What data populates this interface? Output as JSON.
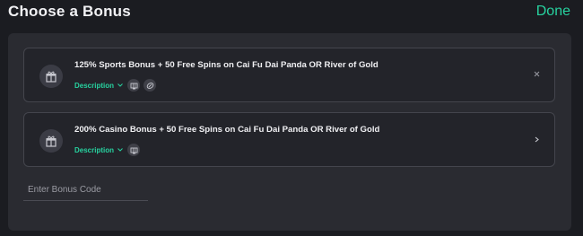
{
  "header": {
    "title": "Choose a Bonus",
    "done_label": "Done"
  },
  "bonuses": [
    {
      "title": "125% Sports Bonus + 50 Free Spins on Cai Fu Dai Panda OR River of Gold",
      "description_label": "Description",
      "icons": [
        "gift-icon",
        "slot-machine-icon",
        "sports-ball-icon"
      ],
      "action_icon": "close-icon"
    },
    {
      "title": "200% Casino Bonus + 50 Free Spins on Cai Fu Dai Panda OR River of Gold",
      "description_label": "Description",
      "icons": [
        "gift-icon",
        "slot-machine-icon"
      ],
      "action_icon": "chevron-right-icon"
    }
  ],
  "bonus_code": {
    "placeholder": "Enter Bonus Code",
    "value": ""
  },
  "colors": {
    "accent": "#27d3a0",
    "background": "#1b1c21",
    "panel": "#2a2b31",
    "card": "#23242a"
  }
}
